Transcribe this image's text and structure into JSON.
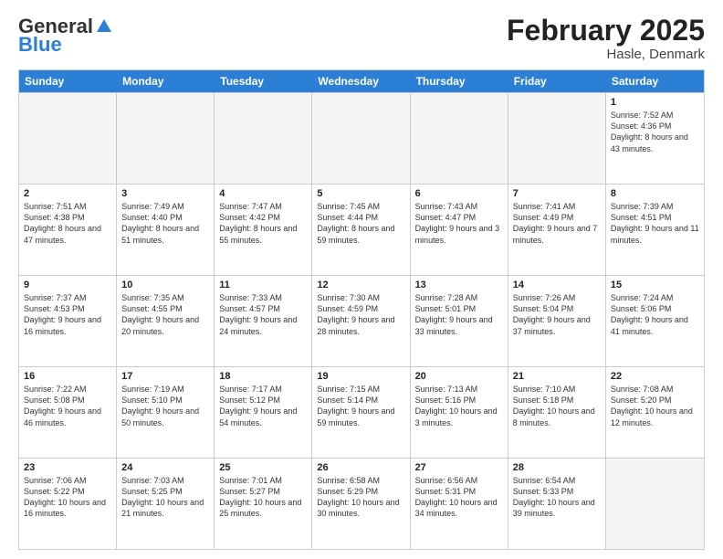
{
  "logo": {
    "general": "General",
    "blue": "Blue"
  },
  "header": {
    "title": "February 2025",
    "subtitle": "Hasle, Denmark"
  },
  "weekdays": [
    "Sunday",
    "Monday",
    "Tuesday",
    "Wednesday",
    "Thursday",
    "Friday",
    "Saturday"
  ],
  "rows": [
    [
      {
        "day": "",
        "empty": true
      },
      {
        "day": "",
        "empty": true
      },
      {
        "day": "",
        "empty": true
      },
      {
        "day": "",
        "empty": true
      },
      {
        "day": "",
        "empty": true
      },
      {
        "day": "",
        "empty": true
      },
      {
        "day": "1",
        "sunrise": "Sunrise: 7:52 AM",
        "sunset": "Sunset: 4:36 PM",
        "daylight": "Daylight: 8 hours and 43 minutes."
      }
    ],
    [
      {
        "day": "2",
        "sunrise": "Sunrise: 7:51 AM",
        "sunset": "Sunset: 4:38 PM",
        "daylight": "Daylight: 8 hours and 47 minutes."
      },
      {
        "day": "3",
        "sunrise": "Sunrise: 7:49 AM",
        "sunset": "Sunset: 4:40 PM",
        "daylight": "Daylight: 8 hours and 51 minutes."
      },
      {
        "day": "4",
        "sunrise": "Sunrise: 7:47 AM",
        "sunset": "Sunset: 4:42 PM",
        "daylight": "Daylight: 8 hours and 55 minutes."
      },
      {
        "day": "5",
        "sunrise": "Sunrise: 7:45 AM",
        "sunset": "Sunset: 4:44 PM",
        "daylight": "Daylight: 8 hours and 59 minutes."
      },
      {
        "day": "6",
        "sunrise": "Sunrise: 7:43 AM",
        "sunset": "Sunset: 4:47 PM",
        "daylight": "Daylight: 9 hours and 3 minutes."
      },
      {
        "day": "7",
        "sunrise": "Sunrise: 7:41 AM",
        "sunset": "Sunset: 4:49 PM",
        "daylight": "Daylight: 9 hours and 7 minutes."
      },
      {
        "day": "8",
        "sunrise": "Sunrise: 7:39 AM",
        "sunset": "Sunset: 4:51 PM",
        "daylight": "Daylight: 9 hours and 11 minutes."
      }
    ],
    [
      {
        "day": "9",
        "sunrise": "Sunrise: 7:37 AM",
        "sunset": "Sunset: 4:53 PM",
        "daylight": "Daylight: 9 hours and 16 minutes."
      },
      {
        "day": "10",
        "sunrise": "Sunrise: 7:35 AM",
        "sunset": "Sunset: 4:55 PM",
        "daylight": "Daylight: 9 hours and 20 minutes."
      },
      {
        "day": "11",
        "sunrise": "Sunrise: 7:33 AM",
        "sunset": "Sunset: 4:57 PM",
        "daylight": "Daylight: 9 hours and 24 minutes."
      },
      {
        "day": "12",
        "sunrise": "Sunrise: 7:30 AM",
        "sunset": "Sunset: 4:59 PM",
        "daylight": "Daylight: 9 hours and 28 minutes."
      },
      {
        "day": "13",
        "sunrise": "Sunrise: 7:28 AM",
        "sunset": "Sunset: 5:01 PM",
        "daylight": "Daylight: 9 hours and 33 minutes."
      },
      {
        "day": "14",
        "sunrise": "Sunrise: 7:26 AM",
        "sunset": "Sunset: 5:04 PM",
        "daylight": "Daylight: 9 hours and 37 minutes."
      },
      {
        "day": "15",
        "sunrise": "Sunrise: 7:24 AM",
        "sunset": "Sunset: 5:06 PM",
        "daylight": "Daylight: 9 hours and 41 minutes."
      }
    ],
    [
      {
        "day": "16",
        "sunrise": "Sunrise: 7:22 AM",
        "sunset": "Sunset: 5:08 PM",
        "daylight": "Daylight: 9 hours and 46 minutes."
      },
      {
        "day": "17",
        "sunrise": "Sunrise: 7:19 AM",
        "sunset": "Sunset: 5:10 PM",
        "daylight": "Daylight: 9 hours and 50 minutes."
      },
      {
        "day": "18",
        "sunrise": "Sunrise: 7:17 AM",
        "sunset": "Sunset: 5:12 PM",
        "daylight": "Daylight: 9 hours and 54 minutes."
      },
      {
        "day": "19",
        "sunrise": "Sunrise: 7:15 AM",
        "sunset": "Sunset: 5:14 PM",
        "daylight": "Daylight: 9 hours and 59 minutes."
      },
      {
        "day": "20",
        "sunrise": "Sunrise: 7:13 AM",
        "sunset": "Sunset: 5:16 PM",
        "daylight": "Daylight: 10 hours and 3 minutes."
      },
      {
        "day": "21",
        "sunrise": "Sunrise: 7:10 AM",
        "sunset": "Sunset: 5:18 PM",
        "daylight": "Daylight: 10 hours and 8 minutes."
      },
      {
        "day": "22",
        "sunrise": "Sunrise: 7:08 AM",
        "sunset": "Sunset: 5:20 PM",
        "daylight": "Daylight: 10 hours and 12 minutes."
      }
    ],
    [
      {
        "day": "23",
        "sunrise": "Sunrise: 7:06 AM",
        "sunset": "Sunset: 5:22 PM",
        "daylight": "Daylight: 10 hours and 16 minutes."
      },
      {
        "day": "24",
        "sunrise": "Sunrise: 7:03 AM",
        "sunset": "Sunset: 5:25 PM",
        "daylight": "Daylight: 10 hours and 21 minutes."
      },
      {
        "day": "25",
        "sunrise": "Sunrise: 7:01 AM",
        "sunset": "Sunset: 5:27 PM",
        "daylight": "Daylight: 10 hours and 25 minutes."
      },
      {
        "day": "26",
        "sunrise": "Sunrise: 6:58 AM",
        "sunset": "Sunset: 5:29 PM",
        "daylight": "Daylight: 10 hours and 30 minutes."
      },
      {
        "day": "27",
        "sunrise": "Sunrise: 6:56 AM",
        "sunset": "Sunset: 5:31 PM",
        "daylight": "Daylight: 10 hours and 34 minutes."
      },
      {
        "day": "28",
        "sunrise": "Sunrise: 6:54 AM",
        "sunset": "Sunset: 5:33 PM",
        "daylight": "Daylight: 10 hours and 39 minutes."
      },
      {
        "day": "",
        "empty": true
      }
    ]
  ]
}
